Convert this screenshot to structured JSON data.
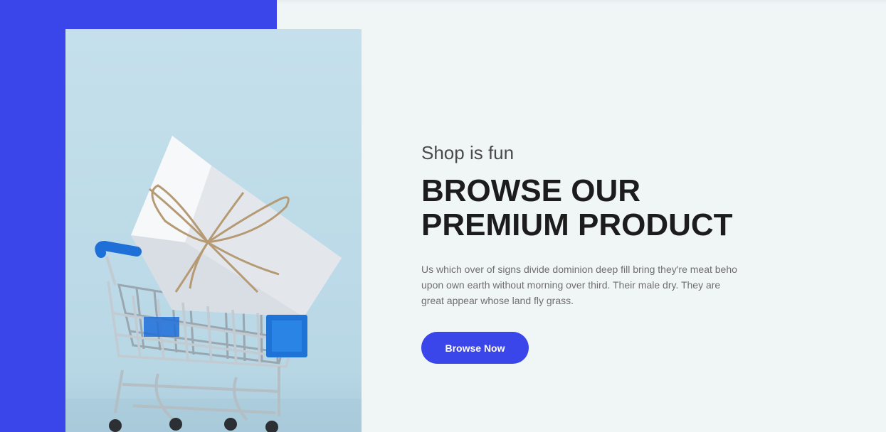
{
  "hero": {
    "subtitle": "Shop is fun",
    "title_line1": "BROWSE OUR",
    "title_line2": "PREMIUM PRODUCT",
    "description": "Us which over of signs divide dominion deep fill bring they're meat beho upon own earth without morning over third. Their male dry. They are great appear whose land fly grass.",
    "button_label": "Browse Now",
    "image_icon": "shopping-cart-with-gift-box"
  },
  "colors": {
    "accent": "#3a46ea",
    "background": "#f0f5f6",
    "heading": "#1c1c1c",
    "body_text": "#6f6f6f",
    "image_bg": "#c5e0ec"
  }
}
